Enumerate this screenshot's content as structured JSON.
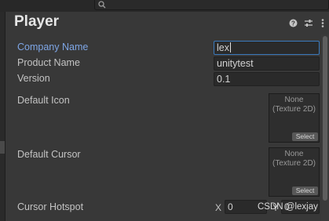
{
  "header": {
    "title": "Player",
    "icons": [
      "help-icon",
      "preset-icon",
      "more-options-icon"
    ]
  },
  "fields": {
    "company_name": {
      "label": "Company Name",
      "value": "lex"
    },
    "product_name": {
      "label": "Product Name",
      "value": "unitytest"
    },
    "version": {
      "label": "Version",
      "value": "0.1"
    }
  },
  "default_icon": {
    "label": "Default Icon",
    "slot_text": "None\n(Texture 2D)",
    "select_label": "Select"
  },
  "default_cursor": {
    "label": "Default Cursor",
    "slot_text": "None\n(Texture 2D)",
    "select_label": "Select"
  },
  "cursor_hotspot": {
    "label": "Cursor Hotspot",
    "x_label": "X",
    "x_value": "0",
    "y_label": "Y",
    "y_value": "0"
  },
  "watermark": "CSDN @lexjay",
  "colors": {
    "background": "#383838",
    "active_label": "#7ea6e6",
    "focus_border": "#3a79bb"
  }
}
